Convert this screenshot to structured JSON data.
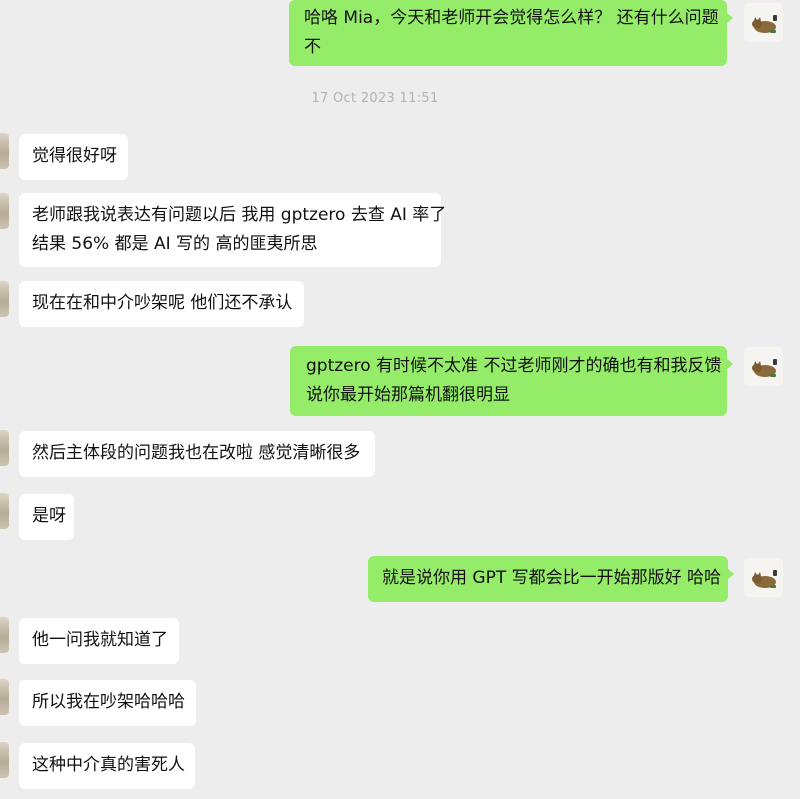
{
  "conversation": {
    "timestamp": "17 Oct 2023 11:51",
    "messages": [
      {
        "sender": "me",
        "lines": [
          "哈咯 Mia，今天和老师开会觉得怎么样？ 还有什么问题",
          "不"
        ]
      },
      {
        "sender": "contact",
        "lines": [
          "觉得很好呀"
        ]
      },
      {
        "sender": "contact",
        "lines": [
          "老师跟我说表达有问题以后 我用 gptzero 去查 AI 率了",
          "结果 56% 都是 AI 写的 高的匪夷所思"
        ]
      },
      {
        "sender": "contact",
        "lines": [
          "现在在和中介吵架呢 他们还不承认"
        ]
      },
      {
        "sender": "me",
        "lines": [
          "gptzero 有时候不太准 不过老师刚才的确也有和我反馈",
          "说你最开始那篇机翻很明显"
        ]
      },
      {
        "sender": "contact",
        "lines": [
          "然后主体段的问题我也在改啦 感觉清晰很多"
        ]
      },
      {
        "sender": "contact",
        "lines": [
          "是呀"
        ]
      },
      {
        "sender": "me",
        "lines": [
          "就是说你用 GPT 写都会比一开始那版好 哈哈"
        ]
      },
      {
        "sender": "contact",
        "lines": [
          "他一问我就知道了"
        ]
      },
      {
        "sender": "contact",
        "lines": [
          "所以我在吵架哈哈哈"
        ]
      },
      {
        "sender": "contact",
        "lines": [
          "这种中介真的害死人"
        ]
      }
    ]
  },
  "colors": {
    "background": "#ededed",
    "outgoing_bubble": "#95ec69",
    "incoming_bubble": "#ffffff",
    "timestamp_text": "#b2b2b2"
  },
  "icons": {
    "my_avatar": "cat-avatar-icon",
    "contact_avatar": "contact-avatar-icon"
  }
}
